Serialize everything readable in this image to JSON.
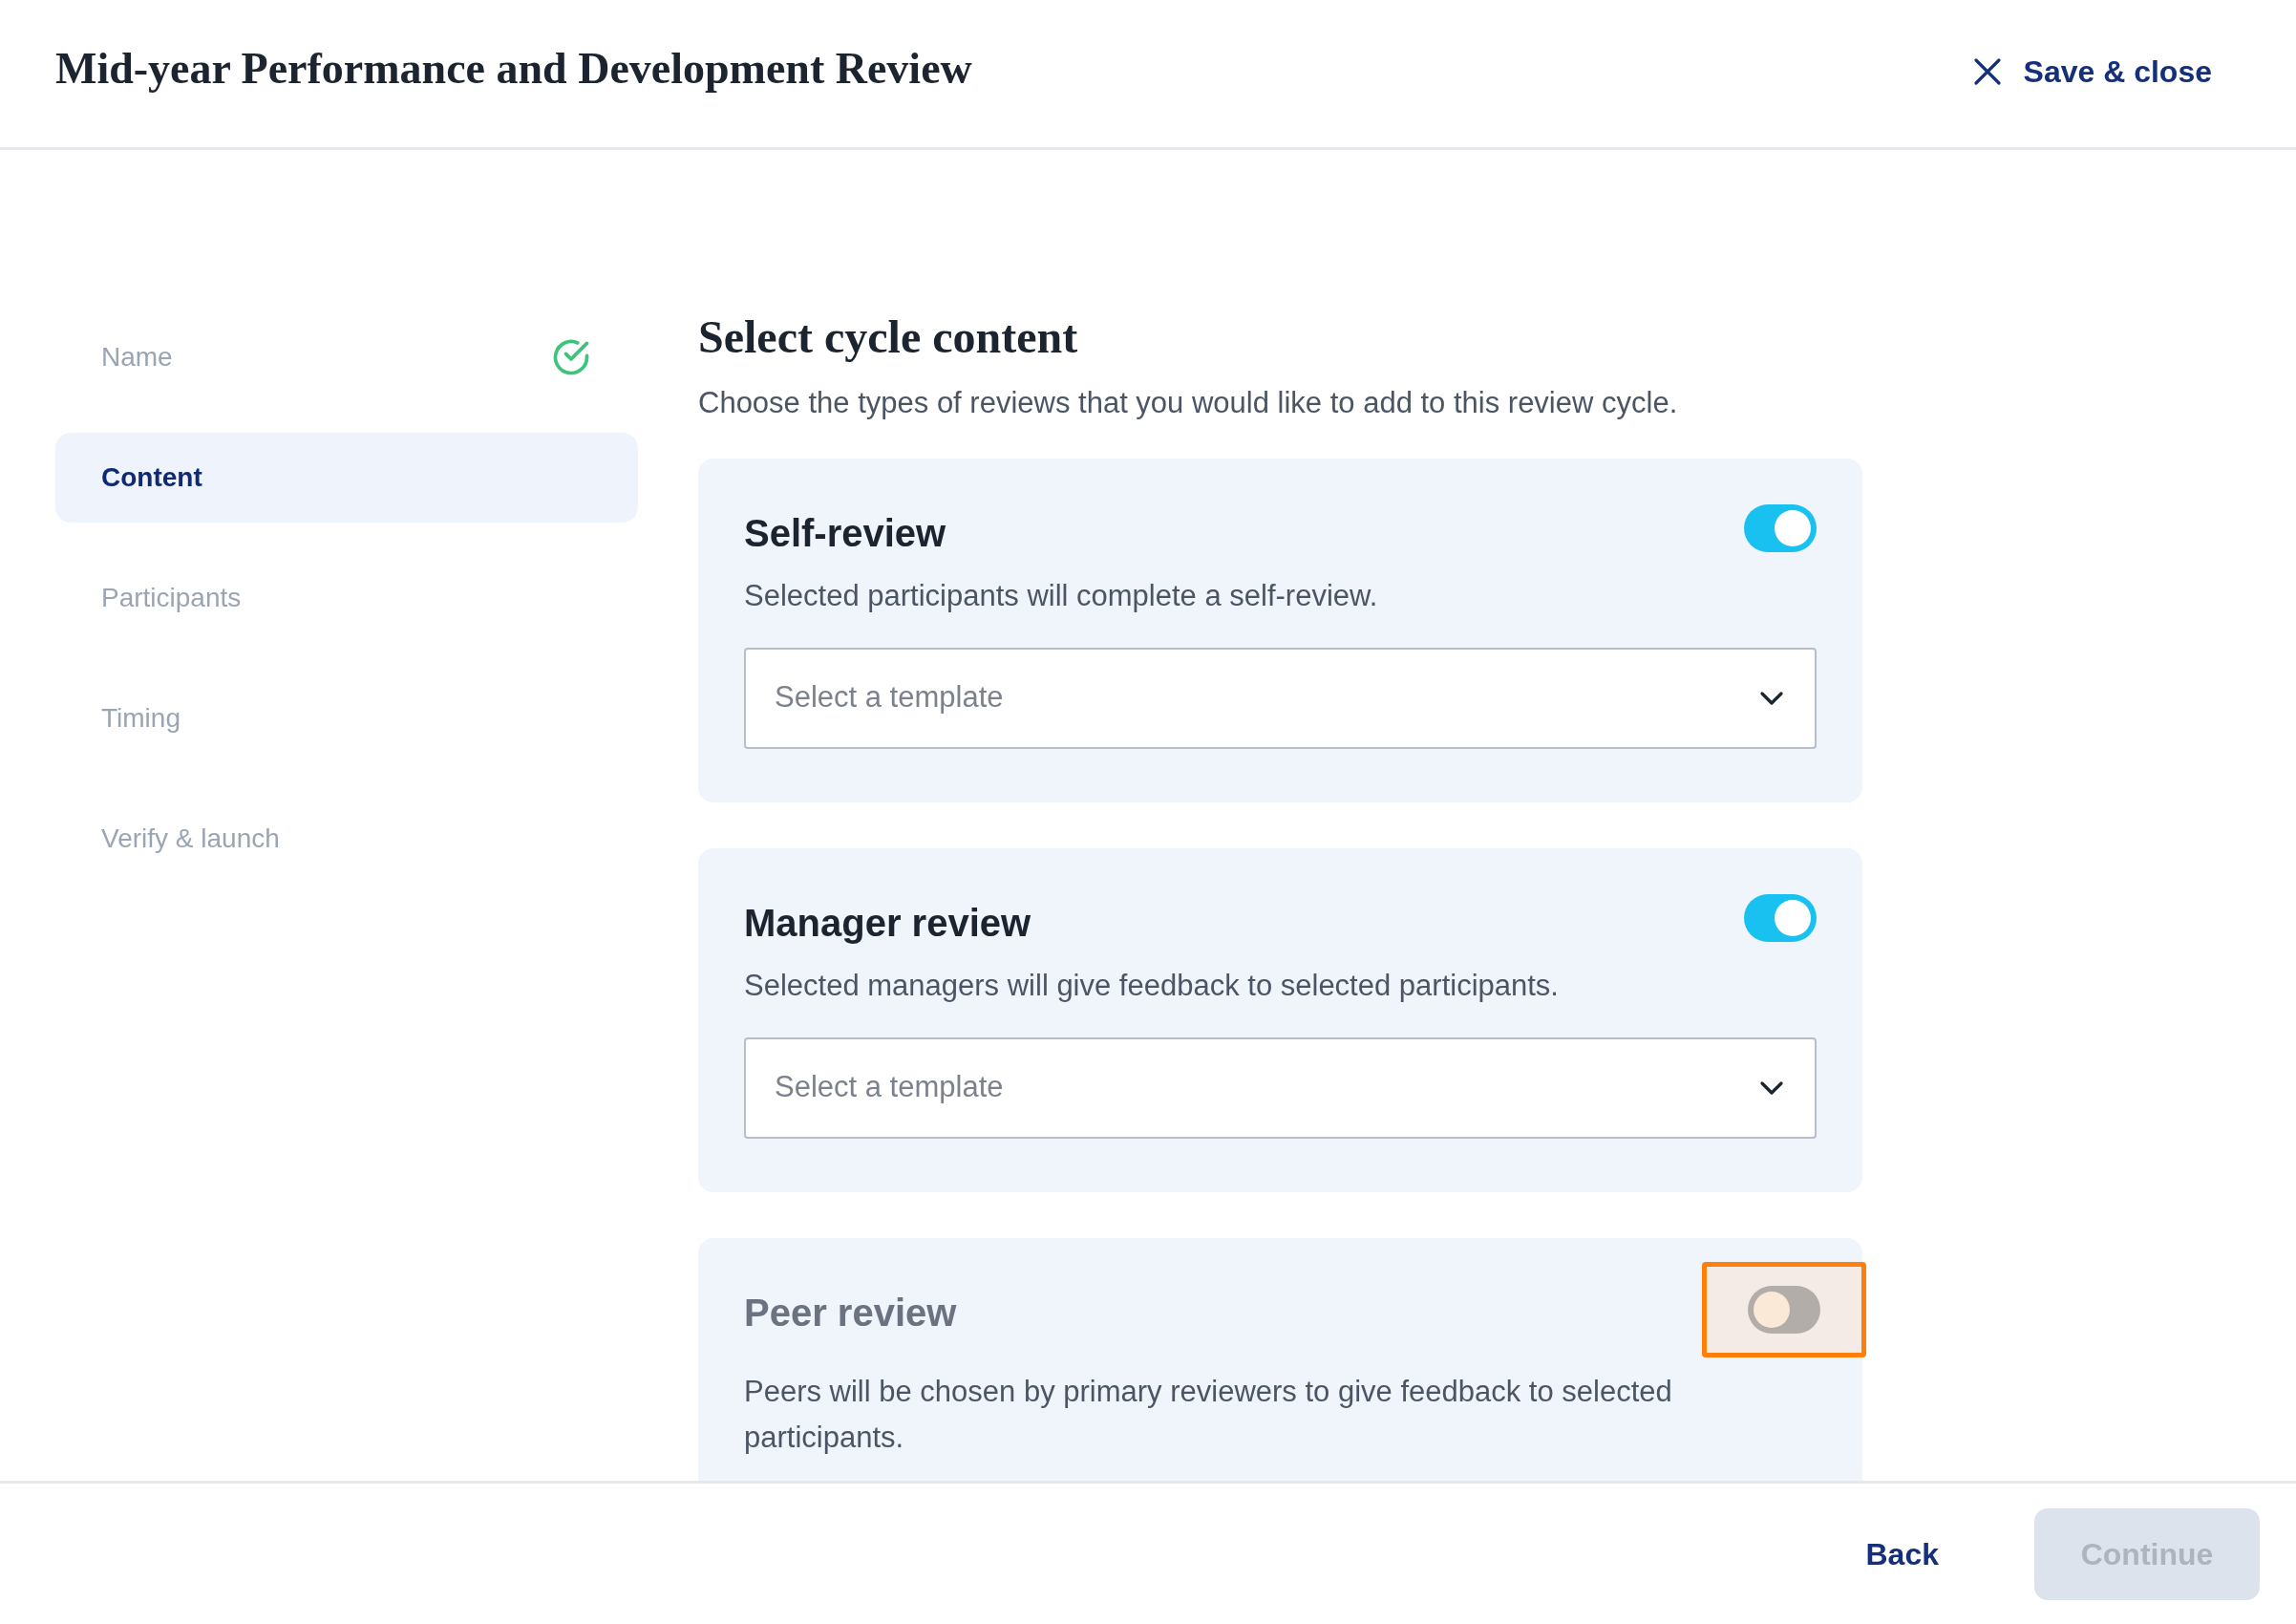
{
  "header": {
    "title": "Mid-year Performance and Development Review",
    "close_label": "Save & close"
  },
  "steps": [
    {
      "label": "Name",
      "selected": false,
      "done": true
    },
    {
      "label": "Content",
      "selected": true,
      "done": false
    },
    {
      "label": "Participants",
      "selected": false,
      "done": false
    },
    {
      "label": "Timing",
      "selected": false,
      "done": false
    },
    {
      "label": "Verify & launch",
      "selected": false,
      "done": false
    }
  ],
  "content": {
    "title": "Select cycle content",
    "description": "Choose the types of reviews that you would like to add to this review cycle.",
    "reviews": [
      {
        "title": "Self-review",
        "description": "Selected participants will complete a self-review.",
        "on": true,
        "highlighted": false,
        "template_placeholder": "Select a template"
      },
      {
        "title": "Manager review",
        "description": "Selected managers will give feedback to selected participants.",
        "on": true,
        "highlighted": false,
        "template_placeholder": "Select a template"
      },
      {
        "title": "Peer review",
        "description": "Peers will be chosen by primary reviewers to give feedback to selected participants.",
        "on": false,
        "highlighted": true
      }
    ]
  },
  "footer": {
    "back": "Back",
    "continue": {
      "label": "Continue",
      "disabled": true
    }
  }
}
